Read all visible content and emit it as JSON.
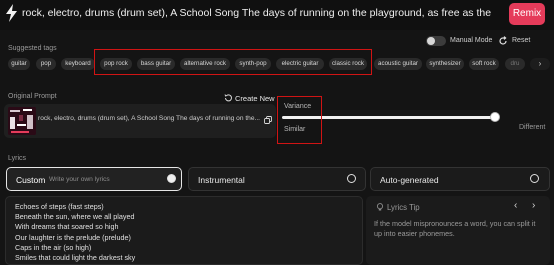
{
  "top": {
    "prompt": "rock, electro, drums (drum set), A School Song The days of running on the playground, as free as the wind, dreams hatching in our school",
    "remix_label": "Remix"
  },
  "tags": {
    "section_label": "Suggested tags",
    "manual_mode_label": "Manual Mode",
    "reset_label": "Reset",
    "items": [
      "guitar",
      "pop",
      "keyboard",
      "pop rock",
      "bass guitar",
      "alternative rock",
      "synth-pop",
      "electric guitar",
      "classic rock",
      "acoustic guitar",
      "synthesizer",
      "soft rock",
      "dru"
    ]
  },
  "original_prompt": {
    "label": "Original Prompt",
    "create_new_label": "Create New",
    "text": "rock, electro, drums (drum set), A School Song The days of running on the..."
  },
  "variance": {
    "label": "Variance",
    "left_label": "Similar",
    "right_label": "Different",
    "value": 0.97
  },
  "lyrics": {
    "label": "Lyrics",
    "options": [
      {
        "label": "Custom",
        "hint": "Write your own lyrics",
        "selected": true
      },
      {
        "label": "Instrumental",
        "hint": "",
        "selected": false
      },
      {
        "label": "Auto-generated",
        "hint": "",
        "selected": false
      }
    ],
    "lines": [
      "Echoes of steps (fast steps)",
      "Beneath the sun, where we all played",
      "With dreams that soared so high",
      "Our laughter is the prelude (prelude)",
      "Caps in the air (so high)",
      "Smiles that could light the darkest sky"
    ],
    "tip_title": "Lyrics Tip",
    "tip_text": "If the model mispronounces a word, you can split it up into easier phonemes."
  },
  "colors": {
    "accent": "#e53b5a",
    "highlight_box": "#d01414"
  }
}
